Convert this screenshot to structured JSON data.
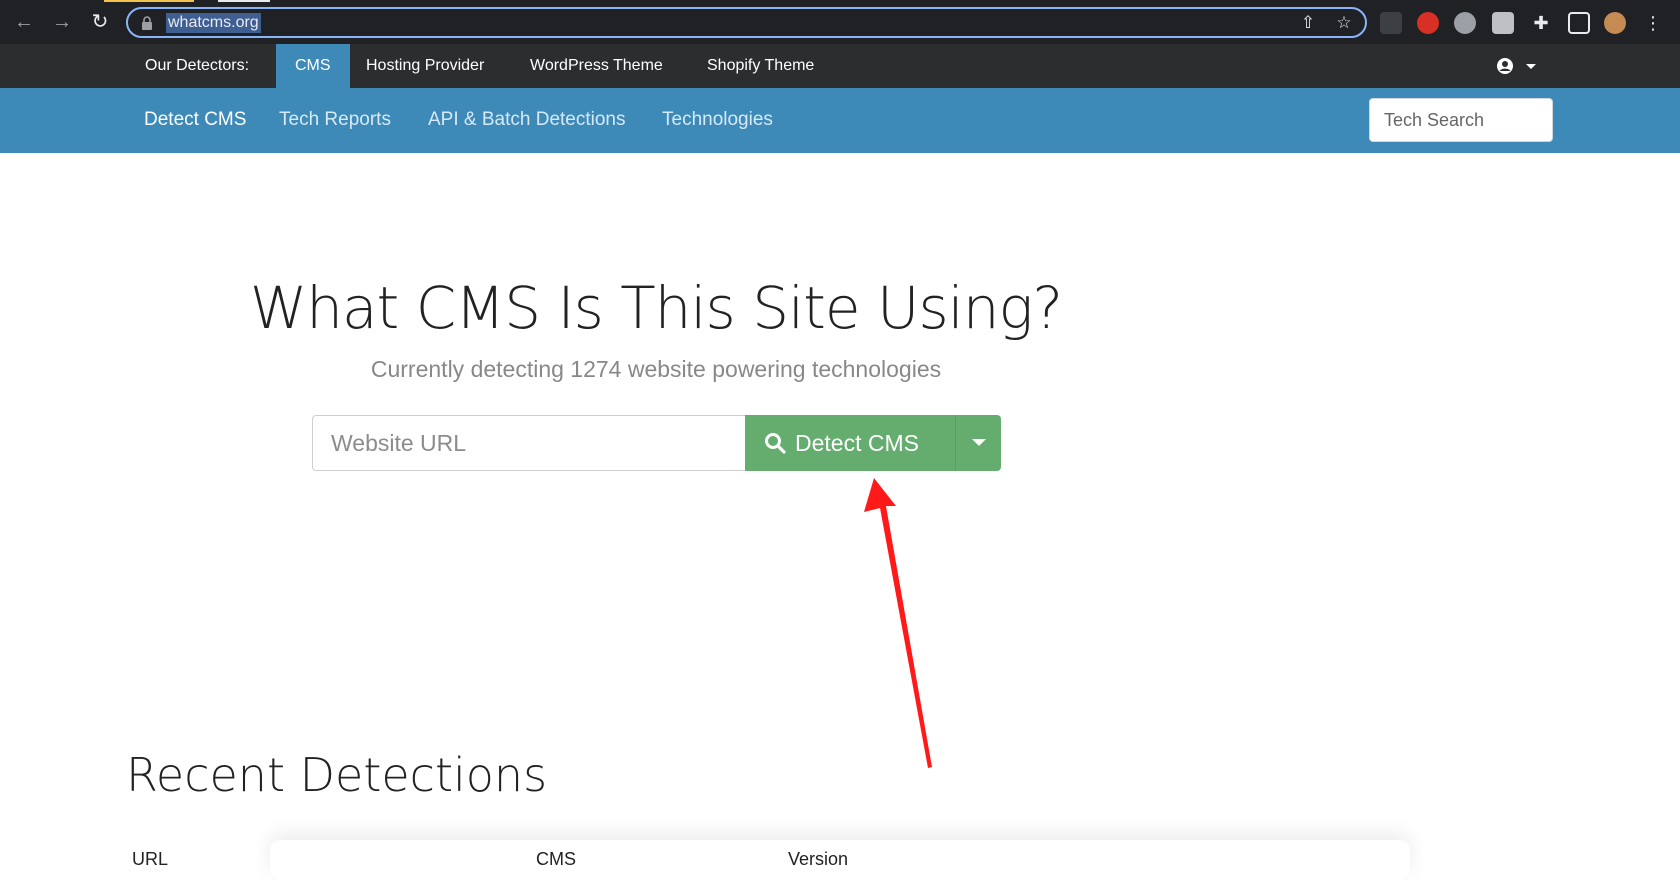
{
  "browser": {
    "url": "whatcms.org",
    "icons": [
      "back-arrow-icon",
      "forward-arrow-icon",
      "reload-icon",
      "lock-icon",
      "share-icon",
      "star-icon",
      "extensions-puzzle-icon",
      "side-panel-icon",
      "profile-avatar-icon",
      "more-menu-icon"
    ]
  },
  "detectors": {
    "label": "Our Detectors:",
    "items": [
      "CMS",
      "Hosting Provider",
      "WordPress Theme",
      "Shopify Theme"
    ],
    "active": "CMS"
  },
  "nav": {
    "items": [
      "Detect CMS",
      "Tech Reports",
      "API & Batch Detections",
      "Technologies"
    ],
    "active": "Detect CMS",
    "search_placeholder": "Tech Search"
  },
  "hero": {
    "title": "What CMS Is This Site Using?",
    "subtitle": "Currently detecting 1274 website powering technologies",
    "input_placeholder": "Website URL",
    "button_label": "Detect CMS"
  },
  "recent": {
    "title": "Recent Detections",
    "columns": [
      "URL",
      "CMS",
      "Version"
    ]
  },
  "colors": {
    "nav_blue": "#3d8ab9",
    "detect_green": "#64ad6f",
    "annotation_red": "#ff1a1a"
  }
}
